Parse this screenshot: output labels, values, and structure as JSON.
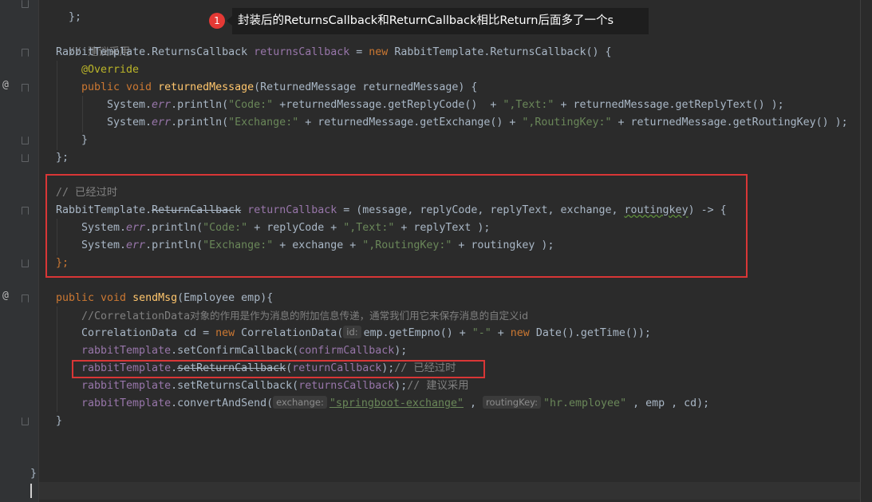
{
  "tooltip": {
    "badge": "1",
    "text": "封装后的ReturnsCallback和ReturnCallback相比Return后面多了一个s"
  },
  "gutter": {
    "override_marker": "@",
    "method_marker": "@"
  },
  "code": {
    "l0_brace": "};",
    "l1_comment": "// 建议采用",
    "l2_type": "RabbitTemplate.ReturnsCallback ",
    "l2_var": "returnsCallback",
    "l2_eq": " = ",
    "l2_new": "new ",
    "l2_ctor": "RabbitTemplate.ReturnsCallback",
    "l2_end": "() {",
    "l3_annotation": "@Override",
    "l4_public": "public void ",
    "l4_method": "returnedMessage",
    "l4_params": "(ReturnedMessage returnedMessage) {",
    "l5_sys": "System.",
    "l5_err": "err",
    "l5_println": ".println(",
    "l5_str1": "\"Code:\"",
    "l5_mid": " +returnedMessage.getReplyCode()  + ",
    "l5_str2": "\",Text:\"",
    "l5_end": " + returnedMessage.getReplyText() );",
    "l6_sys": "System.",
    "l6_err": "err",
    "l6_println": ".println(",
    "l6_str1": "\"Exchange:\"",
    "l6_mid": " + returnedMessage.getExchange() + ",
    "l6_str2": "\",RoutingKey:\"",
    "l6_end": " + returnedMessage.getRoutingKey() );",
    "l7_brace": "}",
    "l8_brace": "};",
    "l9_comment": "// 已经过时",
    "l10_type": "RabbitTemplate.",
    "l10_deprecated": "ReturnCallback",
    "l10_space": " ",
    "l10_var": "returnCallback",
    "l10_params": " = (message, replyCode, replyText, exchange, ",
    "l10_rk": "routingkey",
    "l10_end": ") -> {",
    "l11_sys": "System.",
    "l11_err": "err",
    "l11_println": ".println(",
    "l11_str1": "\"Code:\"",
    "l11_mid": " + replyCode + ",
    "l11_str2": "\",Text:\"",
    "l11_end": " + replyText );",
    "l12_sys": "System.",
    "l12_err": "err",
    "l12_println": ".println(",
    "l12_str1": "\"Exchange:\"",
    "l12_mid": " + exchange + ",
    "l12_str2": "\",RoutingKey:\"",
    "l12_end": " + routingkey );",
    "l13_brace": "};",
    "l14_public": "public void ",
    "l14_method": "sendMsg",
    "l14_params": "(Employee emp){",
    "l15_comment_a": "//CorrelationData",
    "l15_comment_b": "对象的作用是作为消息的附加信息传递，通常我们用它来保存消息的自定义id",
    "l16_type": "CorrelationData cd = ",
    "l16_new": "new ",
    "l16_ctor": "CorrelationData(",
    "l16_hint": "id:",
    "l16_mid": "emp.getEmpno() + ",
    "l16_str": "\"-\"",
    "l16_plus": " + ",
    "l16_new2": "new ",
    "l16_end": "Date().getTime());",
    "l17_field": "rabbitTemplate",
    "l17_call": ".setConfirmCallback(",
    "l17_arg": "confirmCallback",
    "l17_end": ");",
    "l18_field": "rabbitTemplate",
    "l18_dot": ".",
    "l18_deprecated": "setReturnCallback",
    "l18_paren": "(",
    "l18_arg": "returnCallback",
    "l18_end": ");",
    "l18_comment": "// 已经过时",
    "l19_field": "rabbitTemplate",
    "l19_call": ".setReturnsCallback(",
    "l19_arg": "returnsCallback",
    "l19_end": ");",
    "l19_comment": "// 建议采用",
    "l20_field": "rabbitTemplate",
    "l20_call": ".convertAndSend(",
    "l20_hint1": "exchange:",
    "l20_str1": "\"springboot-exchange\"",
    "l20_sep1": " , ",
    "l20_hint2": "routingKey:",
    "l20_str2": "\"hr.employee\"",
    "l20_end": " , emp , cd);",
    "l21_brace": "}",
    "l22_brace": "}"
  }
}
